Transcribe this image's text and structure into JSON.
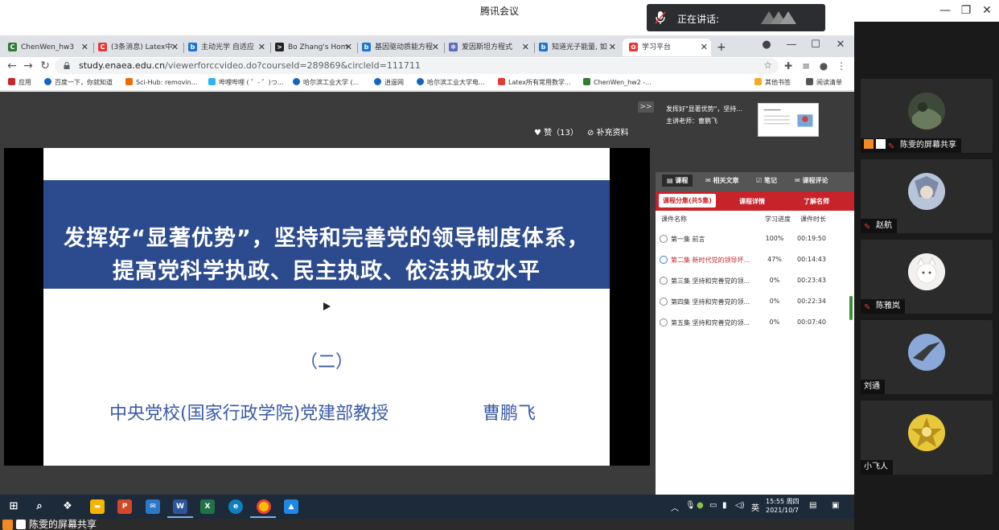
{
  "meeting": {
    "title": "腾讯会议",
    "speaking_label": "正在讲话:",
    "share_label": "陈雯的屏幕共享"
  },
  "browser": {
    "tabs": [
      {
        "label": "ChenWen_hw3",
        "icon": "coursera-icon",
        "color": "#2e7d32"
      },
      {
        "label": "(3条消息) Latex中",
        "icon": "csdn-icon",
        "color": "#e53935"
      },
      {
        "label": "主动光学 自适应",
        "icon": "bing-icon",
        "color": "#1976d2"
      },
      {
        "label": "Bo Zhang's Hom",
        "icon": "terminal-icon",
        "color": "#222222"
      },
      {
        "label": "基因驱动质能方程",
        "icon": "bing-icon",
        "color": "#1976d2"
      },
      {
        "label": "爱因斯坦方程式",
        "icon": "gear-icon",
        "color": "#5c6bc0"
      },
      {
        "label": "知道光子能量, 如",
        "icon": "bing-icon",
        "color": "#1976d2"
      },
      {
        "label": "学习平台",
        "icon": "study-icon",
        "color": "#e53935"
      }
    ],
    "new_tab": "+",
    "url_host": "study.enaea.edu.cn",
    "url_path": "/viewerforccvideo.do?courseId=289869&circleId=111711",
    "bookmarks": [
      {
        "label": "应用",
        "color": "#c62828"
      },
      {
        "label": "百度一下，你就知道",
        "color": "#1565c0"
      },
      {
        "label": "Sci-Hub: removin...",
        "color": "#ef6c00"
      },
      {
        "label": "哔哩哔哩 ( ゜- ゜)つ...",
        "color": "#29b6f6"
      },
      {
        "label": "哈尔滨工业大学 (...",
        "color": "#1565c0"
      },
      {
        "label": "逍遥网",
        "color": "#1565c0"
      },
      {
        "label": "哈尔滨工业大学电...",
        "color": "#1565c0"
      },
      {
        "label": "Latex所有常用数学...",
        "color": "#e53935"
      },
      {
        "label": "ChenWen_hw2 -...",
        "color": "#2e7d32"
      }
    ],
    "bookmarks_right": [
      {
        "label": "其他书签",
        "color": "#f9a825"
      },
      {
        "label": "阅读清单",
        "color": "#555555"
      }
    ]
  },
  "course": {
    "likes": "赞（13）",
    "extra": "补充资料",
    "expand": ">>",
    "slide": {
      "line1": "发挥好“显著优势”，坚持和完善党的领导制度体系，",
      "line2": "提高党科学执政、民主执政、依法执政水平",
      "sub": "（二）",
      "author": "中央党校(国家行政学院)党建部教授",
      "name": "曹鹏飞"
    },
    "sidebar": {
      "title": "发挥好\"显著优势\"，坚持...",
      "teacher": "主讲老师：曹鹏飞",
      "tabs": [
        "课程",
        "相关文章",
        "笔记",
        "课程评论"
      ],
      "subtabs": [
        "课程分集(共5集)",
        "课程详情",
        "了解名师"
      ],
      "columns": [
        "课件名称",
        "学习进度",
        "课件时长"
      ],
      "episodes": [
        {
          "name": "第一集 前言",
          "progress": "100%",
          "duration": "00:19:50"
        },
        {
          "name": "第二集 新时代党的领导坏...",
          "progress": "47%",
          "duration": "00:14:43"
        },
        {
          "name": "第三集 坚持和完善党的领...",
          "progress": "0%",
          "duration": "00:23:43"
        },
        {
          "name": "第四集 坚持和完善党的领...",
          "progress": "0%",
          "duration": "00:22:34"
        },
        {
          "name": "第五集 坚持和完善党的领...",
          "progress": "0%",
          "duration": "00:07:40"
        }
      ]
    }
  },
  "taskbar": {
    "apps": [
      "windows-icon",
      "search-icon",
      "teams-icon",
      "explorer-icon",
      "powerpoint-icon",
      "mail-icon",
      "word-icon",
      "excel-icon",
      "edge-icon",
      "chrome-icon",
      "tencent-meeting-icon"
    ],
    "ime": "英",
    "time": "15:55 周四",
    "date": "2021/10/7"
  },
  "participants": [
    {
      "name": "陈雯的屏幕共享",
      "avatar_color": "#3d4a3a"
    },
    {
      "name": "赵航",
      "avatar_color": "#8a9bb8"
    },
    {
      "name": "陈雅岚",
      "avatar_color": "#f2eeee"
    },
    {
      "name": "刘通",
      "avatar_color": "#6b8cc6"
    },
    {
      "name": "小飞人",
      "avatar_color": "#d8b928"
    }
  ]
}
